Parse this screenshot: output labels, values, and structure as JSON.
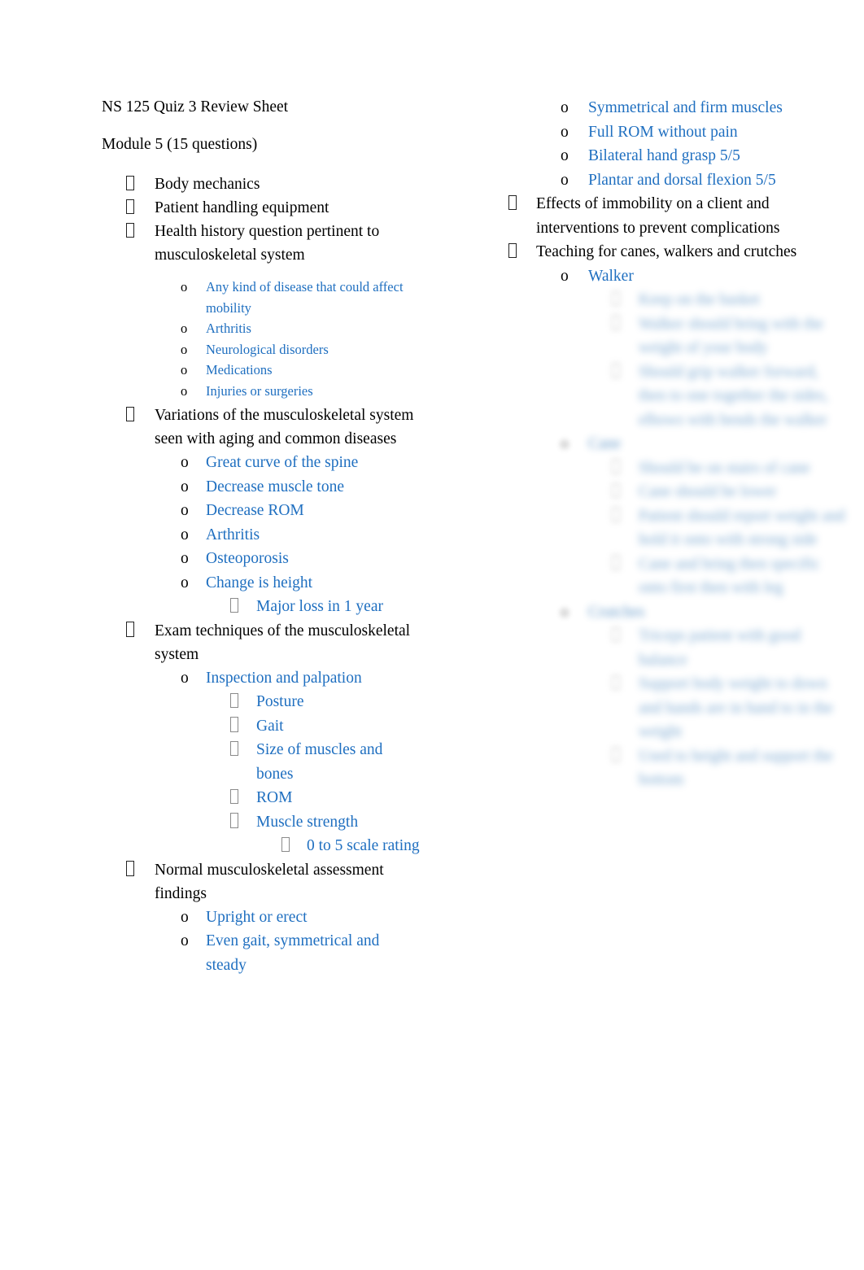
{
  "document": {
    "title": "NS 125 Quiz 3 Review Sheet",
    "module_heading": "Module 5 (15 questions)",
    "accent_color": "#1F6FC0",
    "text_color": "#000000",
    "bullet_level1_glyph": " ",
    "bullet_level3_glyph": " ",
    "bullet_level4_glyph": " ",
    "bullet_o_glyph": "o"
  },
  "left_column": {
    "items": [
      {
        "level": 1,
        "text": "Body mechanics"
      },
      {
        "level": 1,
        "text": "Patient handling equipment"
      },
      {
        "level": 1,
        "text": "Health history question pertinent to musculoskeletal system"
      },
      {
        "level": "2s",
        "text": "Any kind of disease that could affect mobility"
      },
      {
        "level": "2s",
        "text": "Arthritis"
      },
      {
        "level": "2s",
        "text": "Neurological disorders"
      },
      {
        "level": "2s",
        "text": "Medications"
      },
      {
        "level": "2s",
        "text": "Injuries or surgeries"
      },
      {
        "level": 1,
        "text": "Variations of the musculoskeletal system seen with aging and common diseases"
      },
      {
        "level": 2,
        "text": "Great curve of the spine"
      },
      {
        "level": 2,
        "text": "Decrease muscle tone"
      },
      {
        "level": 2,
        "text": "Decrease ROM"
      },
      {
        "level": 2,
        "text": "Arthritis"
      },
      {
        "level": 2,
        "text": "Osteoporosis"
      },
      {
        "level": 2,
        "text": "Change is height"
      },
      {
        "level": 3,
        "text": "Major loss in 1 year"
      },
      {
        "level": 1,
        "text": "Exam techniques of the musculoskeletal system"
      },
      {
        "level": 2,
        "text": "Inspection and palpation"
      },
      {
        "level": 3,
        "text": "Posture"
      },
      {
        "level": 3,
        "text": "Gait"
      },
      {
        "level": 3,
        "text": "Size of muscles and bones"
      },
      {
        "level": 3,
        "text": "ROM"
      },
      {
        "level": 3,
        "text": "Muscle strength"
      },
      {
        "level": 4,
        "text": "0 to 5 scale rating"
      },
      {
        "level": 1,
        "text": "Normal musculoskeletal assessment findings"
      },
      {
        "level": 2,
        "text": "Upright or erect"
      },
      {
        "level": 2,
        "text": "Even gait, symmetrical and steady"
      }
    ]
  },
  "right_column": {
    "items": [
      {
        "level": 2,
        "text": "Symmetrical and firm muscles",
        "redacted": false
      },
      {
        "level": 2,
        "text": "Full ROM without pain",
        "redacted": false
      },
      {
        "level": 2,
        "text": "Bilateral hand grasp 5/5",
        "redacted": false
      },
      {
        "level": 2,
        "text": "Plantar and dorsal flexion 5/5",
        "redacted": false
      },
      {
        "level": 1,
        "text": "Effects of immobility on a client and interventions to prevent complications",
        "redacted": false
      },
      {
        "level": 1,
        "text": "Teaching for canes, walkers and crutches",
        "redacted": false
      },
      {
        "level": 2,
        "text": "Walker",
        "redacted": false
      },
      {
        "level": 3,
        "text": "Keep on the basket",
        "redacted": true
      },
      {
        "level": 3,
        "text": "Walker should bring with the weight of your body",
        "redacted": true
      },
      {
        "level": 3,
        "text": "Should grip walker forward, then to one together the sides, elbows with bends the walker",
        "redacted": true
      },
      {
        "level": 2,
        "text": "Cane",
        "redacted": true
      },
      {
        "level": 3,
        "text": "Should be on stairs of cane",
        "redacted": true
      },
      {
        "level": 3,
        "text": "Cane should be lower",
        "redacted": true
      },
      {
        "level": 3,
        "text": "Patient should report weight and hold it onto with strong side",
        "redacted": true
      },
      {
        "level": 3,
        "text": "Cane and bring then specific onto first then with leg",
        "redacted": true
      },
      {
        "level": 2,
        "text": "Crutches",
        "redacted": true
      },
      {
        "level": 3,
        "text": "Triceps patient with good balance",
        "redacted": true
      },
      {
        "level": 3,
        "text": "Support body weight to down and hands are in hand to in the weight",
        "redacted": true
      },
      {
        "level": 3,
        "text": "Used to height and support the bottom",
        "redacted": true
      }
    ]
  }
}
